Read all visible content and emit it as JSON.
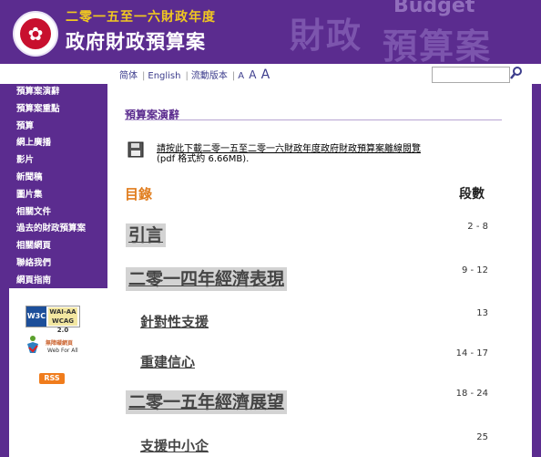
{
  "header": {
    "subtitle": "二零一五至一六財政年度",
    "title": "政府財政預算案",
    "watermark_cn_1": "財政",
    "watermark_cn_2": "預算案",
    "watermark_en": "Budget"
  },
  "utilbar": {
    "trad_chinese": "简体",
    "english": "English",
    "mobile": "流動版本",
    "font_small": "A",
    "font_medium": "A",
    "font_large": "A",
    "search_placeholder": ""
  },
  "sidebar": {
    "items": [
      {
        "label": "預算案演辭"
      },
      {
        "label": "預算案重點"
      },
      {
        "label": "預算"
      },
      {
        "label": "網上廣播"
      },
      {
        "label": "影片"
      },
      {
        "label": "新聞稿"
      },
      {
        "label": "圖片集"
      },
      {
        "label": "相關文件"
      },
      {
        "label": "過去的財政預算案"
      },
      {
        "label": "相關網頁"
      },
      {
        "label": "聯絡我們"
      },
      {
        "label": "網頁指南"
      }
    ],
    "badges": {
      "w3c_left": "W3C",
      "w3c_right_1": "WAI-AA",
      "w3c_right_2": "WCAG 2.0",
      "wfa_title": "無障礙網頁",
      "wfa_sub": "Web For All",
      "rss": "RSS"
    }
  },
  "main": {
    "section_title": "預算案演辭",
    "download_link": "請按此下載二零一五至二零一六財政年度政府財政預算案離線閱覽",
    "download_size": "(pdf 格式約 6.66MB).",
    "toc_label": "目錄",
    "para_label": "段數",
    "toc": [
      {
        "level": 1,
        "label": "引言",
        "paras": "2 - 8"
      },
      {
        "level": 1,
        "label": "二零一四年經濟表現",
        "paras": "9 - 12"
      },
      {
        "level": 2,
        "label": "針對性支援",
        "paras": "13"
      },
      {
        "level": 2,
        "label": "重建信心",
        "paras": "14 - 17"
      },
      {
        "level": 1,
        "label": "二零一五年經濟展望",
        "paras": "18 - 24"
      },
      {
        "level": 2,
        "label": "支援中小企",
        "paras": "25"
      }
    ]
  },
  "colors": {
    "brand_purple": "#5b2c8f",
    "toc_orange": "#e07c1c",
    "header_gold": "#f0c820"
  }
}
